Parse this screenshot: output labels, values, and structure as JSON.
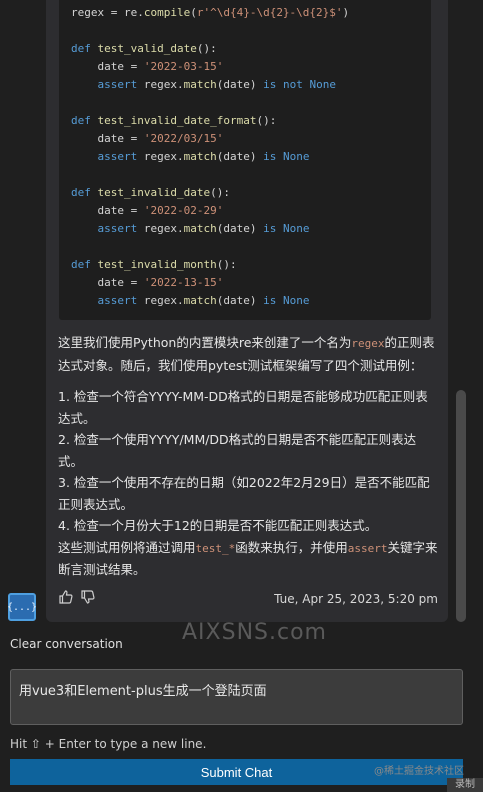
{
  "code": {
    "lines": [
      [
        [
          "plain",
          "regex = re."
        ],
        [
          "fn",
          "compile"
        ],
        [
          "plain",
          "("
        ],
        [
          "str",
          "r'^\\d{4}-\\d{2}-\\d{2}$'"
        ],
        [
          "plain",
          ")"
        ]
      ],
      [],
      [
        [
          "kw",
          "def "
        ],
        [
          "fn",
          "test_valid_date"
        ],
        [
          "plain",
          "():"
        ]
      ],
      [
        [
          "plain",
          "    date = "
        ],
        [
          "str",
          "'2022-03-15'"
        ]
      ],
      [
        [
          "kw",
          "    assert "
        ],
        [
          "plain",
          "regex."
        ],
        [
          "fn",
          "match"
        ],
        [
          "plain",
          "(date) "
        ],
        [
          "kw",
          "is not None"
        ]
      ],
      [],
      [
        [
          "kw",
          "def "
        ],
        [
          "fn",
          "test_invalid_date_format"
        ],
        [
          "plain",
          "():"
        ]
      ],
      [
        [
          "plain",
          "    date = "
        ],
        [
          "str",
          "'2022/03/15'"
        ]
      ],
      [
        [
          "kw",
          "    assert "
        ],
        [
          "plain",
          "regex."
        ],
        [
          "fn",
          "match"
        ],
        [
          "plain",
          "(date) "
        ],
        [
          "kw",
          "is None"
        ]
      ],
      [],
      [
        [
          "kw",
          "def "
        ],
        [
          "fn",
          "test_invalid_date"
        ],
        [
          "plain",
          "():"
        ]
      ],
      [
        [
          "plain",
          "    date = "
        ],
        [
          "str",
          "'2022-02-29'"
        ]
      ],
      [
        [
          "kw",
          "    assert "
        ],
        [
          "plain",
          "regex."
        ],
        [
          "fn",
          "match"
        ],
        [
          "plain",
          "(date) "
        ],
        [
          "kw",
          "is None"
        ]
      ],
      [],
      [
        [
          "kw",
          "def "
        ],
        [
          "fn",
          "test_invalid_month"
        ],
        [
          "plain",
          "():"
        ]
      ],
      [
        [
          "plain",
          "    date = "
        ],
        [
          "str",
          "'2022-13-15'"
        ]
      ],
      [
        [
          "kw",
          "    assert "
        ],
        [
          "plain",
          "regex."
        ],
        [
          "fn",
          "match"
        ],
        [
          "plain",
          "(date) "
        ],
        [
          "kw",
          "is None"
        ]
      ]
    ]
  },
  "answer": {
    "intro_a": "这里我们使用Python的内置模块re来创建了一个名为",
    "intro_code": "regex",
    "intro_b": "的正则表达式对象。随后，我们使用pytest测试框架编写了四个测试用例：",
    "items": [
      "1. 检查一个符合YYYY-MM-DD格式的日期是否能够成功匹配正则表达式。",
      "2. 检查一个使用YYYY/MM/DD格式的日期是否不能匹配正则表达式。",
      "3. 检查一个使用不存在的日期（如2022年2月29日）是否不能匹配正则表达式。",
      "4. 检查一个月份大于12的日期是否不能匹配正则表达式。"
    ],
    "outro_a": "这些测试用例将通过调用",
    "outro_code1": "test_*",
    "outro_b": "函数来执行，并使用",
    "outro_code2": "assert",
    "outro_c": "关键字来断言测试结果。"
  },
  "message": {
    "timestamp": "Tue, Apr 25, 2023, 5:20 pm",
    "avatar_glyph": "{...}"
  },
  "watermark": "AIXSNS.com",
  "controls": {
    "clear_label": "Clear conversation",
    "input_value": "用vue3和Element-plus生成一个登陆页面",
    "hint": "Hit ⇧ + Enter to type a new line.",
    "submit_label": "Submit Chat",
    "juejin": "@稀土掘金技术社区",
    "record": "录制"
  },
  "colors": {
    "keyword": "#569cd6",
    "string": "#ce9178",
    "function": "#dcdcaa",
    "submit": "#0e639c"
  }
}
